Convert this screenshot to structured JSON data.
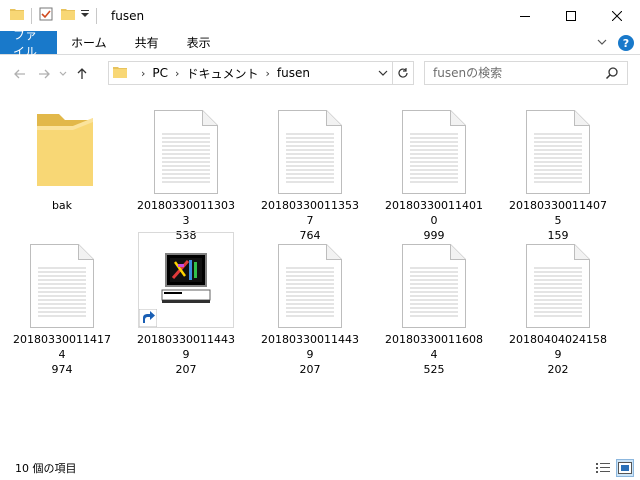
{
  "window": {
    "title": "fusen"
  },
  "ribbon": {
    "tabs": [
      {
        "label": "ファイル"
      },
      {
        "label": "ホーム"
      },
      {
        "label": "共有"
      },
      {
        "label": "表示"
      }
    ]
  },
  "address": {
    "crumbs": [
      "PC",
      "ドキュメント",
      "fusen"
    ]
  },
  "search": {
    "placeholder": "fusenの検索"
  },
  "items": [
    {
      "line1": "bak",
      "line2": "",
      "kind": "folder"
    },
    {
      "line1": "201803300113033",
      "line2": "538",
      "kind": "doc"
    },
    {
      "line1": "201803300113537",
      "line2": "764",
      "kind": "doc"
    },
    {
      "line1": "201803300114010",
      "line2": "999",
      "kind": "doc"
    },
    {
      "line1": "201803300114075",
      "line2": "159",
      "kind": "doc"
    },
    {
      "line1": "201803300114174",
      "line2": "974",
      "kind": "doc"
    },
    {
      "line1": "201803300114439",
      "line2": "207",
      "kind": "shortcut"
    },
    {
      "line1": "201803300114439",
      "line2": "207",
      "kind": "doc"
    },
    {
      "line1": "201803300116084",
      "line2": "525",
      "kind": "doc"
    },
    {
      "line1": "201804040241589",
      "line2": "202",
      "kind": "doc"
    }
  ],
  "status": {
    "count_text": "10 個の項目"
  },
  "colors": {
    "accent": "#1979ca",
    "folder": "#f8d775"
  }
}
